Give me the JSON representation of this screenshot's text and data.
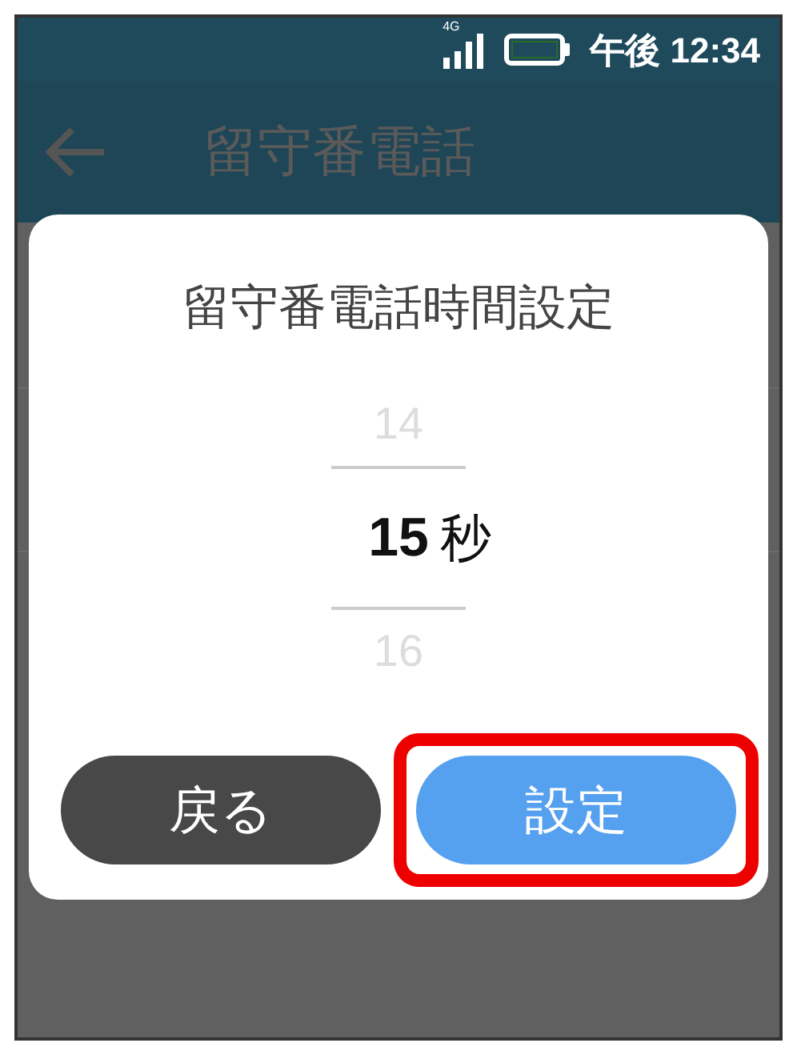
{
  "status_bar": {
    "network": "4G",
    "time": "午後 12:34"
  },
  "app_bar": {
    "title": "留守番電話"
  },
  "dialog": {
    "title": "留守番電話時間設定",
    "picker": {
      "unit": "秒",
      "options": [
        {
          "value": "14",
          "selected": false
        },
        {
          "value": "15",
          "selected": true
        },
        {
          "value": "16",
          "selected": false
        }
      ]
    },
    "buttons": [
      {
        "label": "戻る",
        "kind": "secondary",
        "highlighted": false
      },
      {
        "label": "設定",
        "kind": "primary",
        "highlighted": true
      }
    ]
  }
}
